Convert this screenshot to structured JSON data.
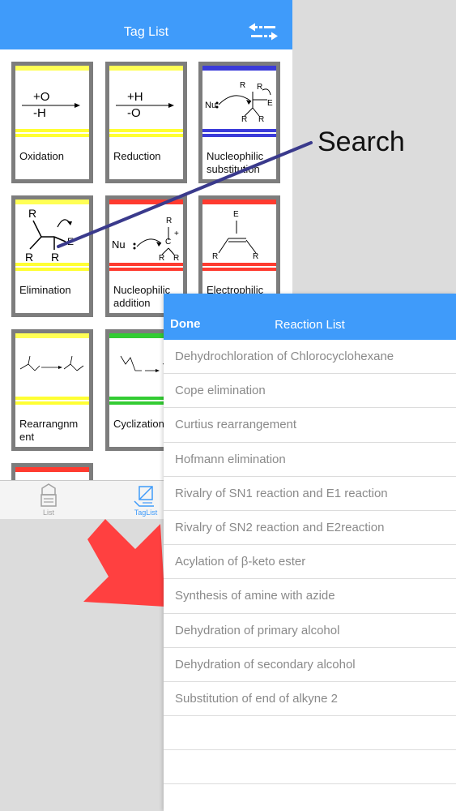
{
  "navbar": {
    "title": "Tag List",
    "swap_icon": "swap-arrows-icon"
  },
  "tags": [
    {
      "label": "Oxidation",
      "top_color": "#ffff55",
      "bar_color": "#ffff33",
      "art": "arrow",
      "art_above": "+O",
      "art_below": "-H"
    },
    {
      "label": "Reduction",
      "top_color": "#ffff55",
      "bar_color": "#ffff33",
      "art": "arrow",
      "art_above": "+H",
      "art_below": "-O"
    },
    {
      "label": "Nucleophilic substitution",
      "top_color": "#3b3bd9",
      "bar_color": "#3b3bd9",
      "art": "nucleophilic-substitution-structure"
    },
    {
      "label": "Elimination",
      "top_color": "#ffff55",
      "bar_color": "#ffff33",
      "art": "elimination-structure"
    },
    {
      "label": "Nucleophilic addition",
      "top_color": "#ff3b30",
      "bar_color": "#ff3b30",
      "art": "nucleophilic-addition-structure"
    },
    {
      "label": "Electrophilic",
      "top_color": "#ff3b30",
      "bar_color": "#ff3b30",
      "art": "electrophilic-structure"
    },
    {
      "label": "Rearrangnm ent",
      "top_color": "#ffff55",
      "bar_color": "#ffff33",
      "art": "rearrangement-structure"
    },
    {
      "label": "Cyclization",
      "top_color": "#33cc33",
      "bar_color": "#33cc33",
      "art": "cyclization-structure"
    },
    {
      "label": "",
      "top_color": "#ffff55",
      "bar_color": "#ffff33",
      "art": ""
    },
    {
      "label": "",
      "top_color": "#ff3b30",
      "bar_color": "#ff3b30",
      "art": ""
    }
  ],
  "tabbar": {
    "tabs": [
      {
        "label": "List",
        "icon": "list-icon",
        "selected": false
      },
      {
        "label": "TagList",
        "icon": "taglist-icon",
        "selected": true
      }
    ],
    "selected_color": "#3f9bfa",
    "unselected_color": "#a0a0a0"
  },
  "annotation": {
    "search_label": "Search"
  },
  "reaction_panel": {
    "done_label": "Done",
    "title": "Reaction List",
    "items": [
      "Dehydrochloration of Chlorocyclohexane",
      "Cope elimination",
      "Curtius rearrangement",
      "Hofmann elimination",
      "Rivalry of SN1 reaction and E1 reaction",
      "Rivalry of SN2 reaction and E2reaction",
      "Acylation of β-keto ester",
      "Synthesis of amine with azide",
      "Dehydration of primary alcohol",
      "Dehydration of secondary alcohol",
      "Substitution of end of alkyne 2"
    ],
    "empty_rows": 3
  },
  "colors": {
    "accent": "#3f9bfa",
    "card_frame": "#7d7d7d",
    "annotation_line": "#3a3a8c",
    "arrow": "#ff4040"
  }
}
